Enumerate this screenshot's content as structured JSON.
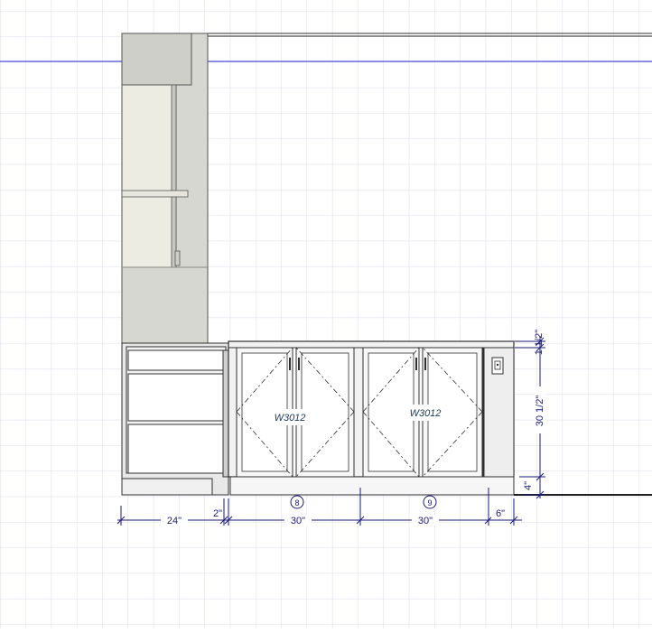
{
  "cabinets": [
    {
      "label": "W3012",
      "number": "8"
    },
    {
      "label": "W3012",
      "number": "9"
    }
  ],
  "dimensions": {
    "horizontal": [
      "24\"",
      "2\"",
      "30\"",
      "30\"",
      "6\""
    ],
    "vertical": [
      "1 1/2\"",
      "30 1/2\"",
      "4\""
    ]
  },
  "colors": {
    "grid": "#d8dce8",
    "guide_line": "#2a2ad0",
    "dimension_line": "#1a1a7a",
    "outline": "#303030"
  }
}
